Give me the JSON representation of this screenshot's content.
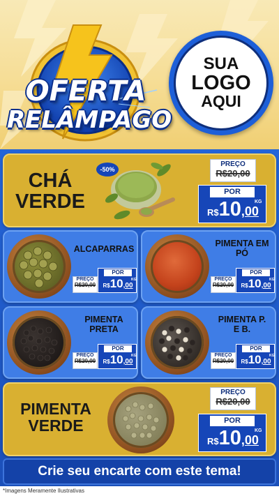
{
  "header": {
    "badge": {
      "line1": "OFERTA",
      "line2": "RELÂMPAGO"
    },
    "logo": {
      "line1": "SUA",
      "line2": "LOGO",
      "line3": "AQUI"
    }
  },
  "products": {
    "featured1": {
      "name_line1": "CHÁ",
      "name_line2": "VERDE",
      "discount": "-50%",
      "preco_label": "PREÇO",
      "old_price": "R$20,00",
      "por_label": "POR",
      "currency": "R$",
      "price_int": "10",
      "price_cents": ",00",
      "unit": "KG"
    },
    "alcaparras": {
      "name": "ALCAPARRAS",
      "preco_label": "PREÇO",
      "old_price": "R$20,00",
      "por_label": "POR",
      "currency": "R$",
      "price_int": "10",
      "price_cents": ",00",
      "unit": "KG"
    },
    "pimenta_po": {
      "name_line1": "PIMENTA EM",
      "name_line2": "PÓ",
      "preco_label": "PREÇO",
      "old_price": "R$20,00",
      "por_label": "POR",
      "currency": "R$",
      "price_int": "10",
      "price_cents": ",00",
      "unit": "KG"
    },
    "pimenta_preta": {
      "name_line1": "PIMENTA",
      "name_line2": "PRETA",
      "preco_label": "PREÇO",
      "old_price": "R$20,00",
      "por_label": "POR",
      "currency": "R$",
      "price_int": "10",
      "price_cents": ",00",
      "unit": "KG"
    },
    "pimenta_pb": {
      "name_line1": "PIMENTA P.",
      "name_line2": "E B.",
      "preco_label": "PREÇO",
      "old_price": "R$20,00",
      "por_label": "POR",
      "currency": "R$",
      "price_int": "10",
      "price_cents": ",00",
      "unit": "KG"
    },
    "featured2": {
      "name_line1": "PIMENTA",
      "name_line2": "VERDE",
      "preco_label": "PREÇO",
      "old_price": "R$20,00",
      "por_label": "POR",
      "currency": "R$",
      "price_int": "10",
      "price_cents": ",00",
      "unit": "KG"
    }
  },
  "cta": {
    "text": "Crie seu encarte com este tema!"
  },
  "footer": {
    "note": "*Imagens Meramente Ilustrativas"
  },
  "colors": {
    "header_bg": "#f6dd95",
    "gold_card": "#d9b031",
    "blue_card": "#3f7de6",
    "body_blue": "#1c4fc0",
    "price_blue": "#1646b8"
  }
}
